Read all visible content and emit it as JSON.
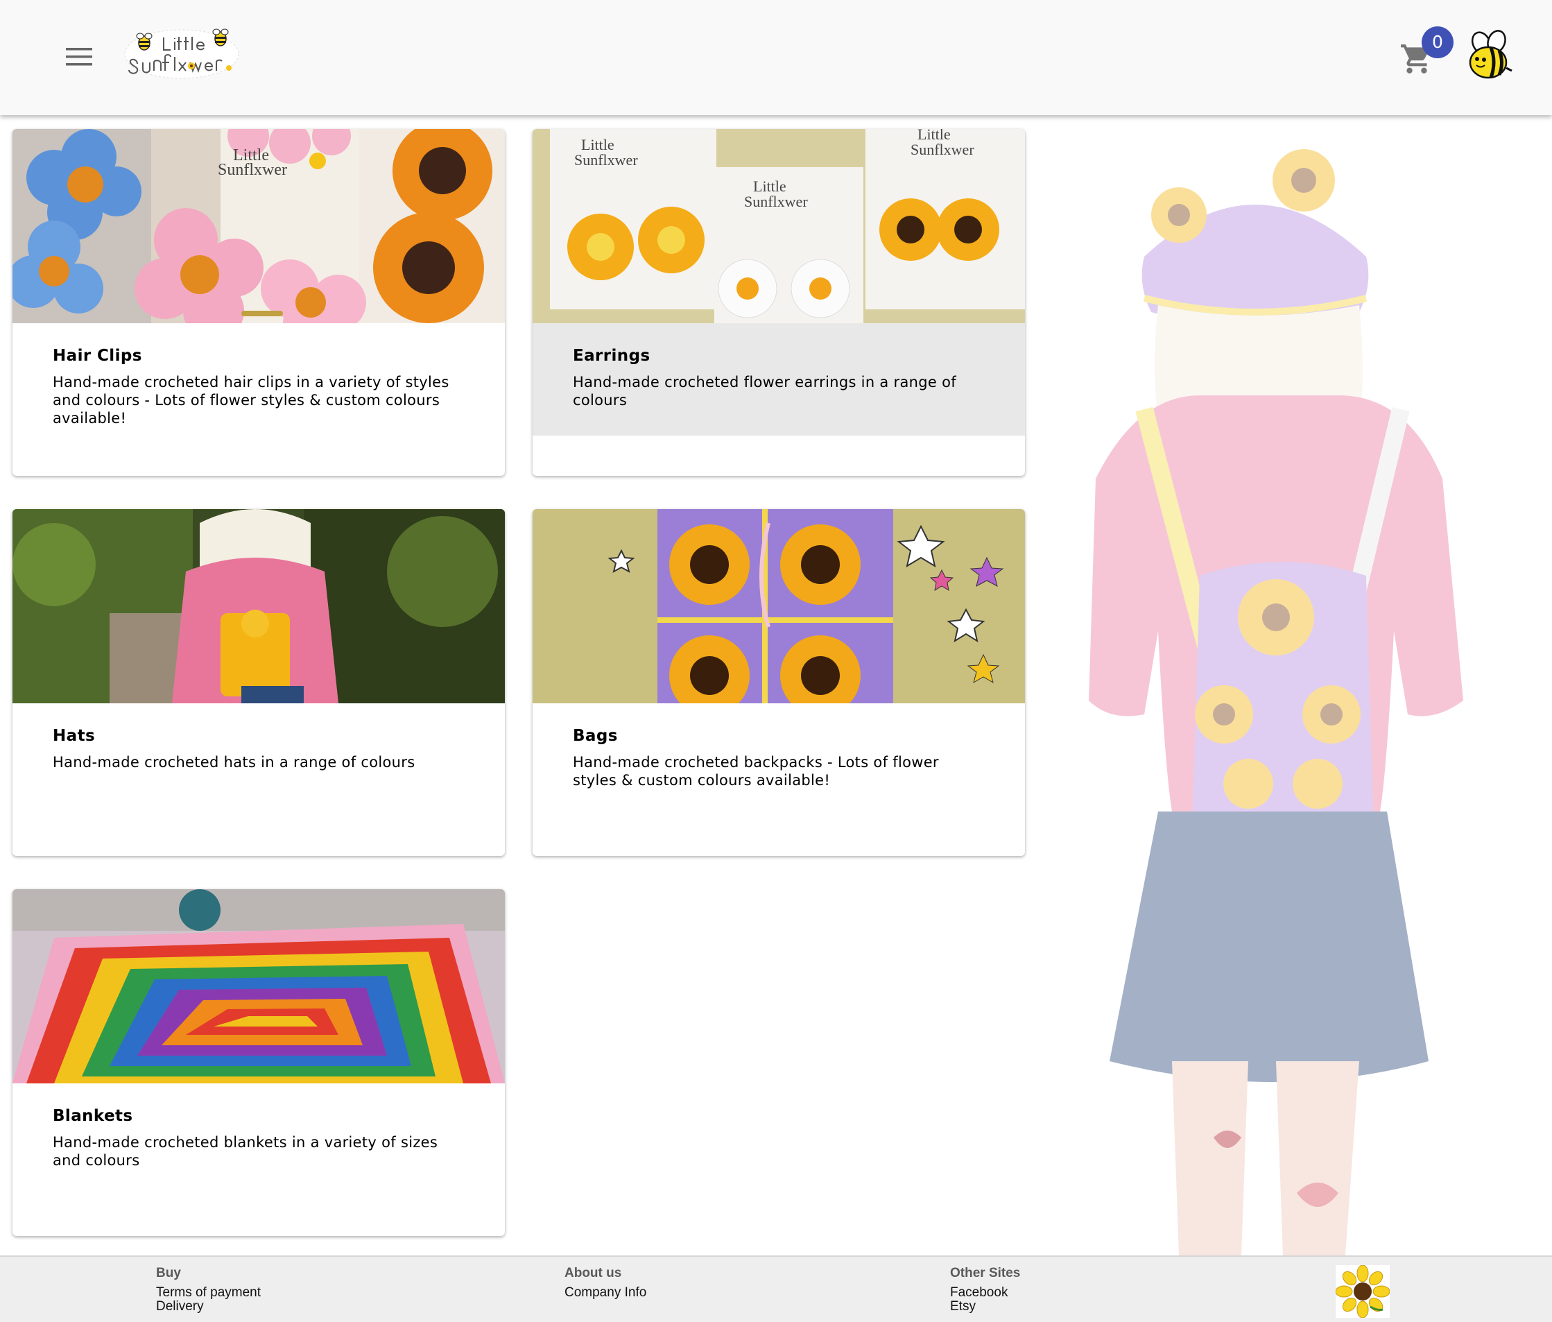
{
  "header": {
    "menu_icon": "hamburger-menu-icon",
    "logo_alt": "Little Sunflxwer",
    "cart_icon": "shopping-cart-icon",
    "cart_count": "0",
    "avatar_icon": "bee-icon"
  },
  "categories": [
    {
      "title": "Hair Clips",
      "description": "Hand-made crocheted hair clips in a variety of styles and colours - Lots of flower styles & custom colours available!"
    },
    {
      "title": "Earrings",
      "description": "Hand-made crocheted flower earrings in a range of colours"
    },
    {
      "title": "Hats",
      "description": "Hand-made crocheted hats in a range of colours"
    },
    {
      "title": "Bags",
      "description": "Hand-made crocheted backpacks - Lots of flower styles & custom colours available!"
    },
    {
      "title": "Blankets",
      "description": "Hand-made crocheted blankets in a variety of sizes and colours"
    }
  ],
  "footer": {
    "buy": {
      "heading": "Buy",
      "links": [
        "Terms of payment",
        "Delivery"
      ]
    },
    "about": {
      "heading": "About us",
      "links": [
        "Company Info"
      ]
    },
    "other": {
      "heading": "Other Sites",
      "links": [
        "Facebook",
        "Etsy"
      ]
    },
    "flower_icon": "sunflower-icon"
  },
  "colors": {
    "badge": "#3f51b5",
    "header_bg": "#f9f9f9",
    "footer_bg": "#eeeeee",
    "highlight_card": "#e8e8e8"
  }
}
